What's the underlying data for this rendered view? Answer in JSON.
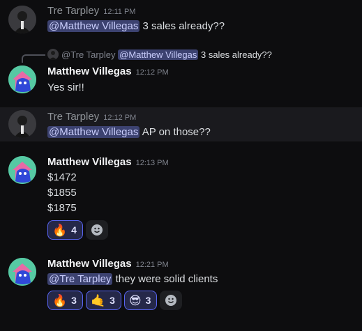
{
  "messages": [
    {
      "author": "Tre Tarpley",
      "time": "12:11 PM",
      "mention": "@Matthew Villegas",
      "text": "3 sales already??"
    },
    {
      "reply_to": {
        "author": "@Tre Tarpley",
        "mention": "@Matthew Villegas",
        "text": "3 sales already??"
      },
      "author": "Matthew Villegas",
      "time": "12:12 PM",
      "text": "Yes sir!!"
    },
    {
      "author": "Tre Tarpley",
      "time": "12:12 PM",
      "mention": "@Matthew Villegas",
      "text": "AP on those??"
    },
    {
      "author": "Matthew Villegas",
      "time": "12:13 PM",
      "lines": [
        "$1472",
        "$1855",
        "$1875"
      ],
      "reactions": [
        {
          "emoji": "fire-emoji",
          "glyph": "🔥",
          "count": "4"
        }
      ]
    },
    {
      "author": "Matthew Villegas",
      "time": "12:21 PM",
      "mention": "@Tre Tarpley",
      "text": "they were solid clients",
      "reactions": [
        {
          "emoji": "fire-emoji",
          "glyph": "🔥",
          "count": "3"
        },
        {
          "emoji": "call-me-hand-emoji",
          "glyph": "🤙",
          "count": "3"
        },
        {
          "emoji": "sunglasses-emoji",
          "glyph": "😎",
          "count": "3"
        }
      ]
    }
  ],
  "colors": {
    "background": "#0d0d0f",
    "mention_bg": "#3c4270",
    "reaction_border": "#5865f2"
  }
}
